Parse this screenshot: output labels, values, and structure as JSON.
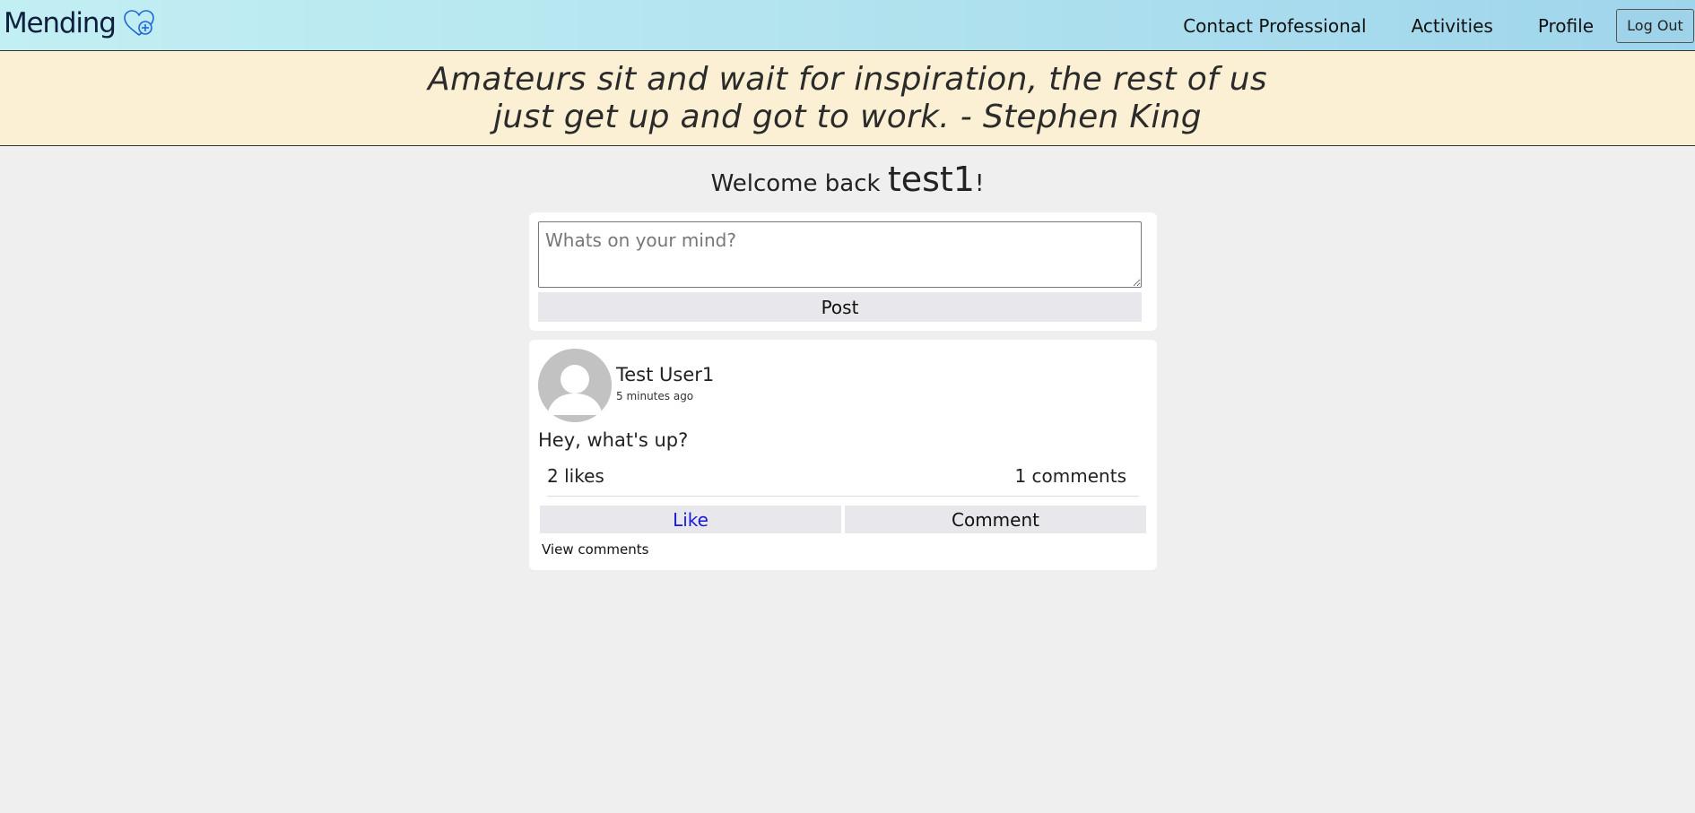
{
  "navbar": {
    "brand": "Mending",
    "brand_icon": "heart-plus-icon",
    "links": {
      "contact": "Contact Professional",
      "activities": "Activities",
      "profile": "Profile"
    },
    "logout_label": "Log Out"
  },
  "quote": {
    "text": "Amateurs sit and wait for inspiration, the rest of us just get up and got to work. - Stephen King"
  },
  "welcome": {
    "prefix": "Welcome back ",
    "username": "test1",
    "suffix": "!"
  },
  "composer": {
    "placeholder": "Whats on your mind?",
    "post_label": "Post"
  },
  "post": {
    "author": "Test User1",
    "timestamp": "5 minutes ago",
    "body": "Hey, what's up?",
    "likes": "2 likes",
    "comments": "1 comments",
    "like_label": "Like",
    "comment_label": "Comment",
    "view_comments": "View comments",
    "avatar_icon": "default-user-avatar"
  },
  "colors": {
    "nav_gradient_start": "#c2eff3",
    "nav_gradient_end": "#9fd5ec",
    "quote_background": "#fbf0d4",
    "page_background": "#efefef",
    "like_text": "#1a1ad6",
    "brand_text": "#0f1f3d",
    "brand_icon": "#1e66d8"
  }
}
